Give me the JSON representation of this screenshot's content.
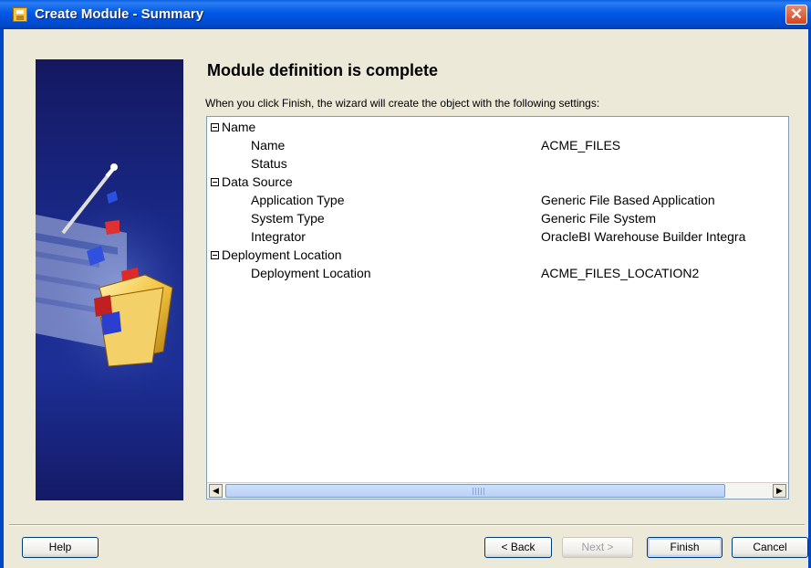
{
  "window": {
    "title": "Create Module - Summary",
    "close_glyph": "✕"
  },
  "heading": "Module definition is complete",
  "intro": "When you click Finish, the wizard will create the object with the following settings:",
  "tree": {
    "groups": [
      {
        "label": "Name",
        "items": [
          {
            "label": "Name",
            "value": "ACME_FILES"
          },
          {
            "label": "Status",
            "value": ""
          }
        ]
      },
      {
        "label": "Data Source",
        "items": [
          {
            "label": "Application Type",
            "value": "Generic File Based Application"
          },
          {
            "label": "System Type",
            "value": "Generic File System"
          },
          {
            "label": "Integrator",
            "value": "OracleBI Warehouse Builder Integra"
          }
        ]
      },
      {
        "label": "Deployment Location",
        "items": [
          {
            "label": "Deployment Location",
            "value": "ACME_FILES_LOCATION2"
          }
        ]
      }
    ]
  },
  "scrollbar": {
    "left_arrow": "◀",
    "right_arrow": "▶"
  },
  "buttons": {
    "help": "Help",
    "back": "< Back",
    "next": "Next >",
    "finish": "Finish",
    "cancel": "Cancel"
  },
  "colors": {
    "titlebar": "#0058e6",
    "dialog_bg": "#ece9d8",
    "art_bg": "#1a2a8a",
    "close": "#d8431b"
  }
}
